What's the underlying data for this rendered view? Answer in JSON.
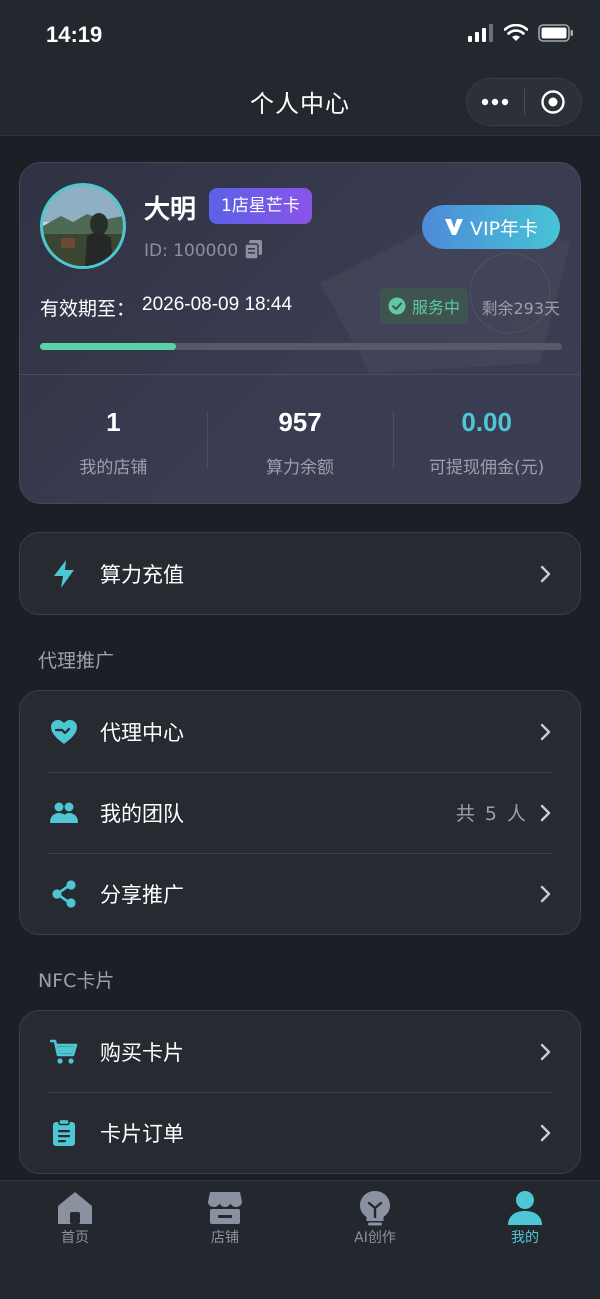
{
  "status_bar": {
    "time": "14:19"
  },
  "header": {
    "title": "个人中心"
  },
  "profile": {
    "name": "大明",
    "badge": "1店星芒卡",
    "id_text": "ID: 100000",
    "vip_label": "VIP年卡",
    "expire_label": "有效期至：",
    "expire_value": "2026-08-09 18:44",
    "service_status": "服务中",
    "remaining": "剩余293天",
    "progress": 0.26
  },
  "stats": [
    {
      "value": "1",
      "label": "我的店铺"
    },
    {
      "value": "957",
      "label": "算力余额"
    },
    {
      "value": "0.00",
      "label": "可提现佣金(元)"
    }
  ],
  "recharge": {
    "label": "算力充值"
  },
  "agent_section": {
    "title": "代理推广",
    "items": [
      {
        "label": "代理中心",
        "icon": "heart-handshake-icon",
        "extra": ""
      },
      {
        "label": "我的团队",
        "icon": "team-icon",
        "extra": "共 5 人"
      },
      {
        "label": "分享推广",
        "icon": "share-icon",
        "extra": ""
      }
    ]
  },
  "nfc_section": {
    "title": "NFC卡片",
    "items": [
      {
        "label": "购买卡片",
        "icon": "cart-icon"
      },
      {
        "label": "卡片订单",
        "icon": "clipboard-icon"
      }
    ]
  },
  "tabs": [
    {
      "label": "首页",
      "icon": "home-icon",
      "active": false
    },
    {
      "label": "店铺",
      "icon": "store-icon",
      "active": false
    },
    {
      "label": "AI创作",
      "icon": "bulb-icon",
      "active": false
    },
    {
      "label": "我的",
      "icon": "user-icon",
      "active": true
    }
  ],
  "colors": {
    "accent": "#4fc6d4",
    "background": "#1c1f25",
    "card": "#272a31",
    "badge_gradient": [
      "#5a62e6",
      "#8a54e8"
    ],
    "service_green": "#5ec9a0"
  }
}
